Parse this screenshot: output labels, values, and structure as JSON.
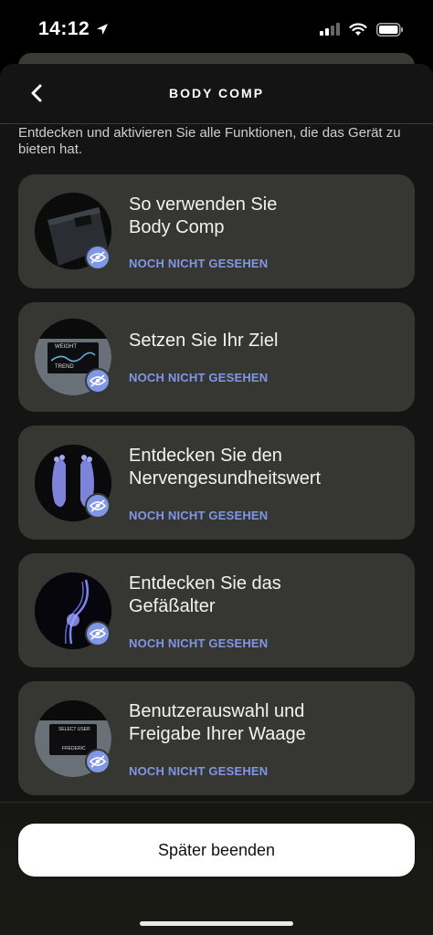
{
  "status_bar": {
    "time": "14:12"
  },
  "header": {
    "title": "BODY COMP"
  },
  "intro": "Entdecken und aktivieren Sie alle Funktionen, die das Gerät zu bieten hat.",
  "cards": [
    {
      "title": "So verwenden Sie Body Comp",
      "status": "NOCH NICHT GESEHEN"
    },
    {
      "title": "Setzen Sie Ihr Ziel",
      "status": "NOCH NICHT GESEHEN",
      "thumb_labels": {
        "weight": "WEIGHT",
        "trend": "TREND"
      }
    },
    {
      "title": "Entdecken Sie den Nervengesundheitswert",
      "status": "NOCH NICHT GESEHEN"
    },
    {
      "title": "Entdecken Sie das Gefäßalter",
      "status": "NOCH NICHT GESEHEN"
    },
    {
      "title": "Benutzerauswahl und Freigabe Ihrer Waage",
      "status": "NOCH NICHT GESEHEN",
      "thumb_labels": {
        "select": "SELECT USER",
        "user": "FREDERIC"
      }
    }
  ],
  "footer": {
    "button_label": "Später beenden"
  },
  "colors": {
    "accent": "#7f97e6",
    "card_bg": "#363732",
    "sheet_bg": "#141414"
  },
  "icons": [
    "location-arrow-icon",
    "signal-icon",
    "wifi-icon",
    "battery-icon",
    "chevron-left-icon",
    "eye-icon"
  ]
}
